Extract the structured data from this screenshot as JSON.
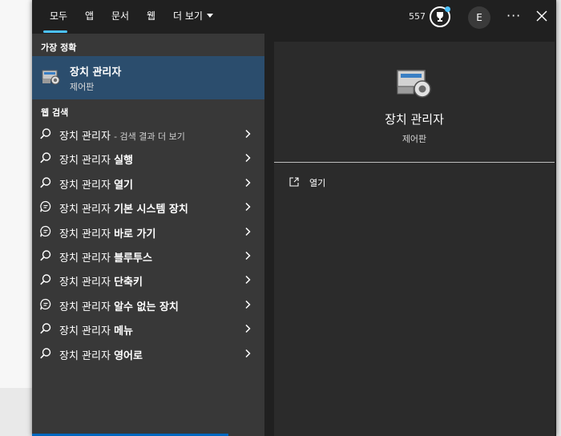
{
  "tabs": [
    {
      "label": "모두",
      "active": true
    },
    {
      "label": "앱"
    },
    {
      "label": "문서"
    },
    {
      "label": "웹"
    },
    {
      "label": "더 보기"
    }
  ],
  "header": {
    "points": "557",
    "avatar_initial": "E",
    "more_label": "···",
    "accent_color": "#4cc2ff"
  },
  "best_match": {
    "section_label": "가장 정확",
    "title": "장치 관리자",
    "subtitle": "제어판",
    "icon": "device-manager-icon",
    "selected_color": "#2b4d6d"
  },
  "web_search": {
    "section_label": "웹 검색",
    "items": [
      {
        "prefix": "장치 관리자",
        "bold": "",
        "suffix": "- 검색 결과 더 보기",
        "icon": "search-icon"
      },
      {
        "prefix": "장치 관리자 ",
        "bold": "실행",
        "suffix": "",
        "icon": "search-icon"
      },
      {
        "prefix": "장치 관리자 ",
        "bold": "열기",
        "suffix": "",
        "icon": "search-icon"
      },
      {
        "prefix": "장치 관리자 ",
        "bold": "기본 시스템 장치",
        "suffix": "",
        "icon": "chat-search-icon"
      },
      {
        "prefix": "장치 관리자 ",
        "bold": "바로 가기",
        "suffix": "",
        "icon": "chat-search-icon"
      },
      {
        "prefix": "장치 관리자 ",
        "bold": "블루투스",
        "suffix": "",
        "icon": "search-icon"
      },
      {
        "prefix": "장치 관리자 ",
        "bold": "단축키",
        "suffix": "",
        "icon": "search-icon"
      },
      {
        "prefix": "장치 관리자 ",
        "bold": "알수 없는 장치",
        "suffix": "",
        "icon": "chat-search-icon"
      },
      {
        "prefix": "장치 관리자 ",
        "bold": "메뉴",
        "suffix": "",
        "icon": "search-icon"
      },
      {
        "prefix": "장치 관리자 ",
        "bold": "영어로",
        "suffix": "",
        "icon": "search-icon"
      }
    ]
  },
  "preview": {
    "title": "장치 관리자",
    "subtitle": "제어판",
    "actions": [
      {
        "label": "열기",
        "icon": "open-external-icon"
      }
    ]
  }
}
